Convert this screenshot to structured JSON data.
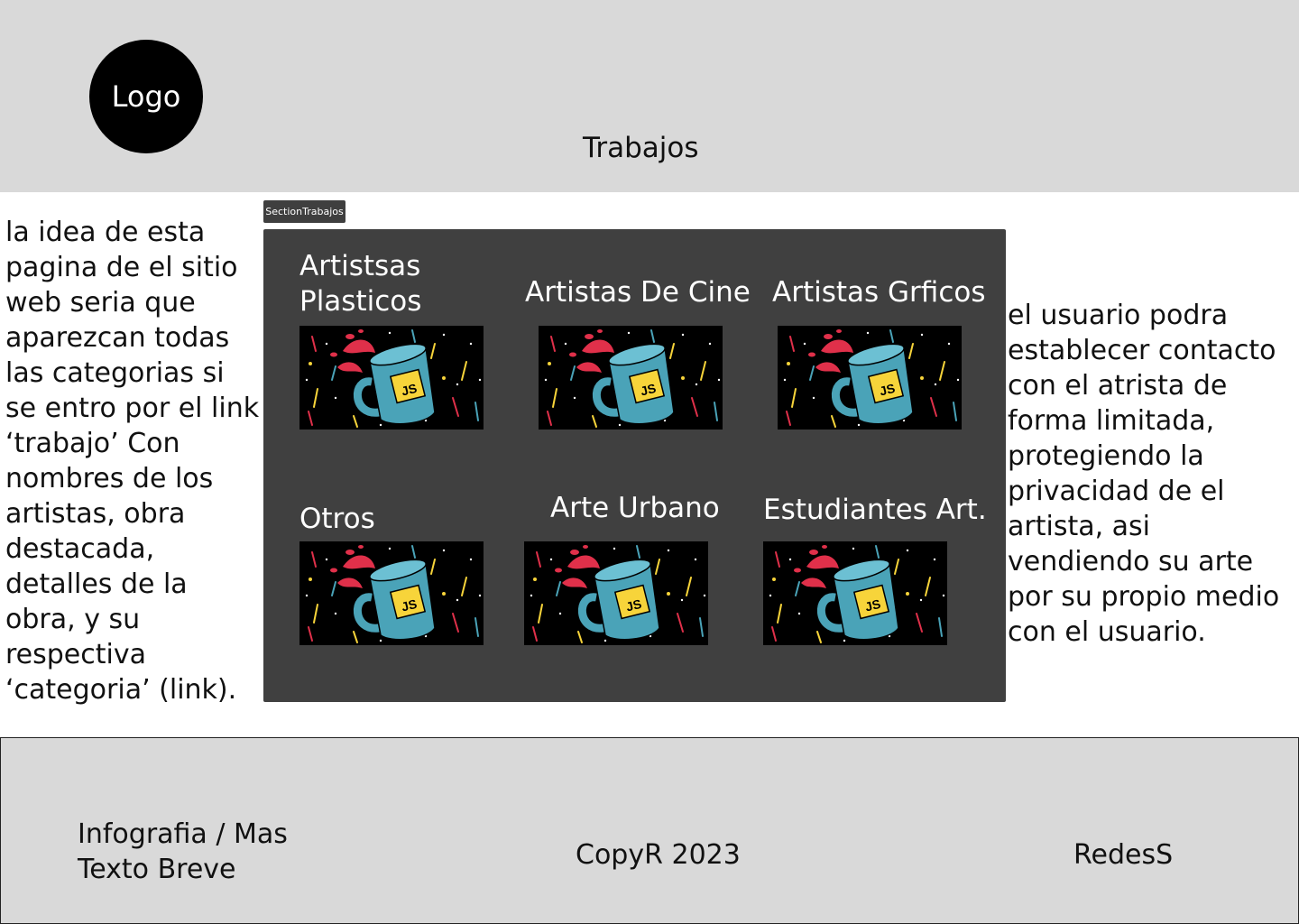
{
  "header": {
    "logo_text": "Logo",
    "nav_link": "Trabajos"
  },
  "left_note": "la idea de esta pagina de el sitio web seria que aparezcan todas las categorias si se entro por el link ‘trabajo’  Con nombres de los artistas, obra destacada, detalles de la obra, y su respectiva ‘categoria’ (link).",
  "right_note": "el usuario podra establecer contacto con el atrista de forma limitada, protegiendo la privacidad de el artista, asi vendiendo su arte por su propio medio con el usuario.",
  "section": {
    "tag": "SectionTrabajos",
    "categories": [
      {
        "label": "Artistsas Plasticos",
        "image_icon": "js-mug-icon"
      },
      {
        "label": "Artistas De Cine",
        "image_icon": "js-mug-icon"
      },
      {
        "label": "Artistas Grficos",
        "image_icon": "js-mug-icon"
      },
      {
        "label": "Otros",
        "image_icon": "js-mug-icon"
      },
      {
        "label": "Arte Urbano",
        "image_icon": "js-mug-icon"
      },
      {
        "label": "Estudiantes Art.",
        "image_icon": "js-mug-icon"
      }
    ]
  },
  "footer": {
    "left_text": "Infografia / Mas Texto Breve",
    "center_text": "CopyR 2023",
    "right_text": "RedesS"
  },
  "colors": {
    "header_bg": "#d9d9d9",
    "section_bg": "#404040",
    "mug_blue": "#4aa3b8",
    "badge_yellow": "#f7d43a",
    "accent_red": "#e0304a"
  }
}
